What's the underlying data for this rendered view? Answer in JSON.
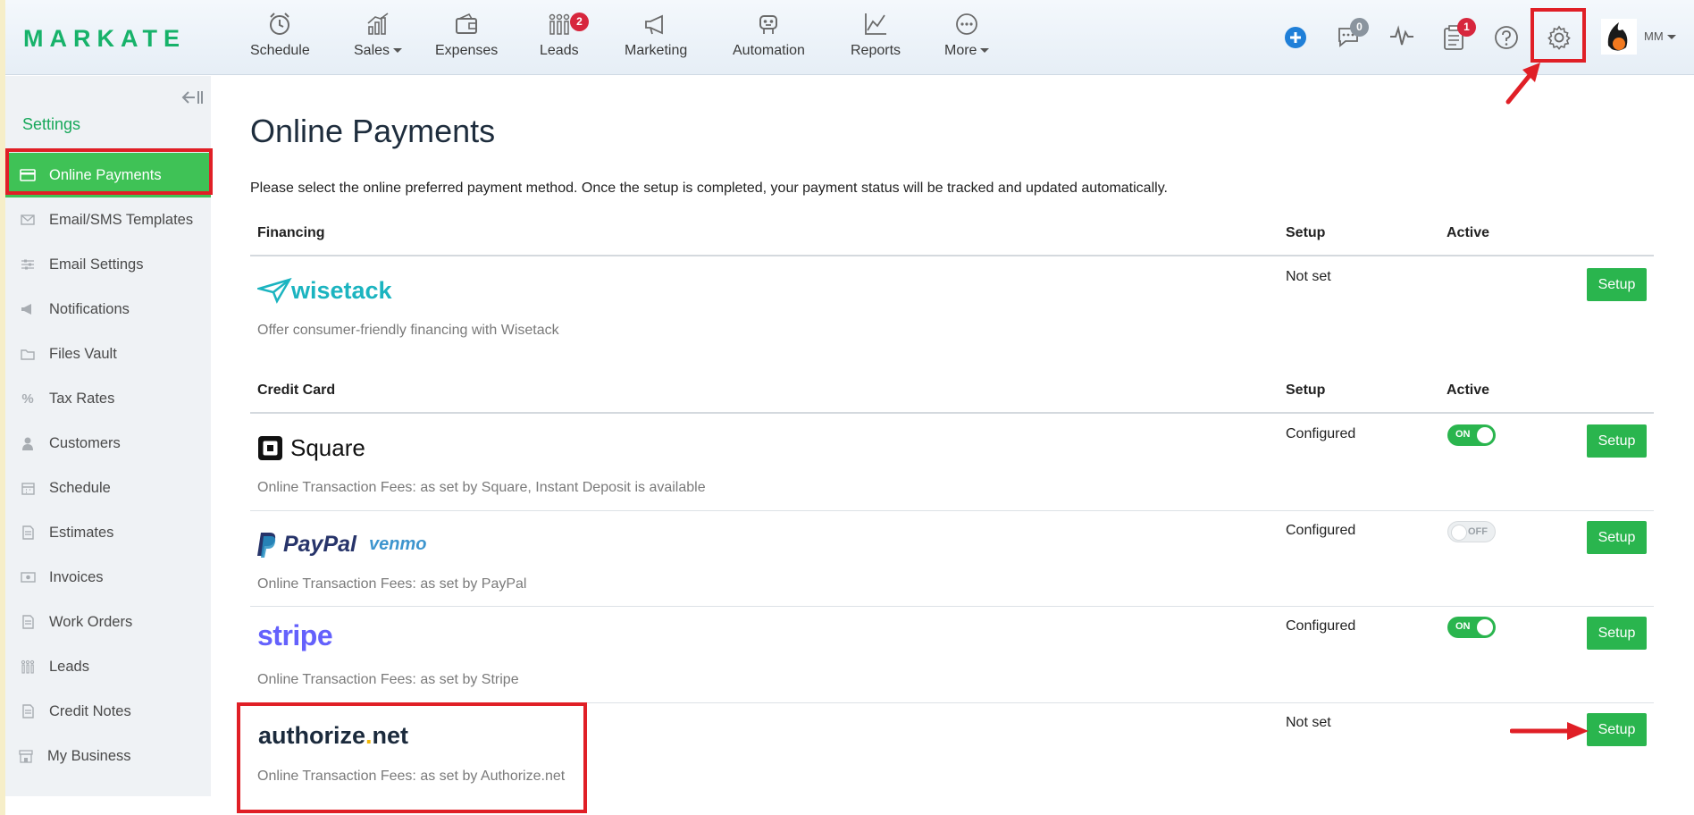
{
  "brand": {
    "logo_text": "MARKATE",
    "accent": "#17b26a"
  },
  "nav": {
    "items": [
      {
        "label": "Schedule",
        "icon": "alarm-clock-icon"
      },
      {
        "label": "Sales",
        "icon": "sales-chart-icon",
        "dropdown": true
      },
      {
        "label": "Expenses",
        "icon": "wallet-icon"
      },
      {
        "label": "Leads",
        "icon": "leads-icon",
        "badge": "2"
      },
      {
        "label": "Marketing",
        "icon": "megaphone-icon"
      },
      {
        "label": "Automation",
        "icon": "robot-icon"
      },
      {
        "label": "Reports",
        "icon": "line-chart-icon"
      },
      {
        "label": "More",
        "icon": "more-dots-icon",
        "dropdown": true
      }
    ],
    "messages_badge": "0",
    "tasks_badge": "1",
    "user_initials": "MM"
  },
  "sidebar": {
    "title": "Settings",
    "items": [
      {
        "label": "Online Payments",
        "icon": "credit-card-icon",
        "active": true
      },
      {
        "label": "Email/SMS Templates",
        "icon": "envelope-icon"
      },
      {
        "label": "Email Settings",
        "icon": "sliders-icon"
      },
      {
        "label": "Notifications",
        "icon": "megaphone-icon"
      },
      {
        "label": "Files Vault",
        "icon": "folder-icon"
      },
      {
        "label": "Tax Rates",
        "icon": "percent-icon"
      },
      {
        "label": "Customers",
        "icon": "person-icon"
      },
      {
        "label": "Schedule",
        "icon": "calendar-icon"
      },
      {
        "label": "Estimates",
        "icon": "document-icon"
      },
      {
        "label": "Invoices",
        "icon": "money-icon"
      },
      {
        "label": "Work Orders",
        "icon": "document-icon"
      },
      {
        "label": "Leads",
        "icon": "leads-icon"
      },
      {
        "label": "Credit Notes",
        "icon": "document-icon"
      },
      {
        "label": "My Business",
        "icon": "store-icon"
      }
    ]
  },
  "main": {
    "title": "Online Payments",
    "intro": "Please select the online preferred payment method. Once the setup is completed, your payment status will be tracked and updated automatically.",
    "financing": {
      "header": "Financing",
      "setup_header": "Setup",
      "active_header": "Active",
      "providers": [
        {
          "name": "wisetack",
          "description": "Offer consumer-friendly financing with Wisetack",
          "status": "Not set",
          "button": "Setup"
        }
      ]
    },
    "credit_card": {
      "header": "Credit Card",
      "setup_header": "Setup",
      "active_header": "Active",
      "providers": [
        {
          "name": "Square",
          "description": "Online Transaction Fees: as set by Square, Instant Deposit is available",
          "status": "Configured",
          "active": "ON",
          "button": "Setup"
        },
        {
          "name": "PayPal",
          "name2": "venmo",
          "description": "Online Transaction Fees: as set by PayPal",
          "status": "Configured",
          "active": "OFF",
          "button": "Setup"
        },
        {
          "name": "stripe",
          "description": "Online Transaction Fees: as set by Stripe",
          "status": "Configured",
          "active": "ON",
          "button": "Setup"
        },
        {
          "name": "authorize",
          "name_dot": ".",
          "name_suffix": "net",
          "description": "Online Transaction Fees: as set by Authorize.net",
          "status": "Not set",
          "button": "Setup"
        }
      ]
    }
  },
  "colors": {
    "green": "#2ab54e",
    "highlight_red": "#e01f26",
    "sidebar_active": "#3fc256"
  }
}
